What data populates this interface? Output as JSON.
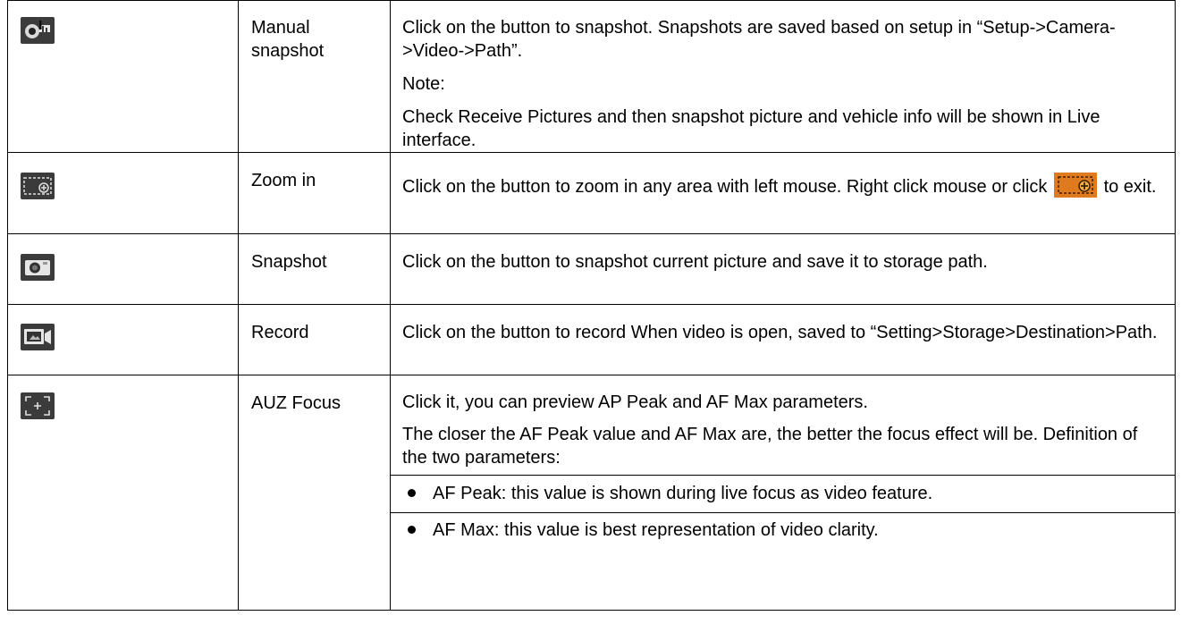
{
  "rows": [
    {
      "icon": "manual-snapshot-icon",
      "name": "Manual\nsnapshot",
      "desc": [
        "Click on the button to snapshot. Snapshots are saved based on setup in “Setup->Camera->Video->Path”.",
        "Note:",
        "Check Receive Pictures and then snapshot picture and vehicle info will be shown in Live interface."
      ]
    },
    {
      "icon": "zoom-in-icon",
      "name": "Zoom in",
      "desc_a": "Click on the button to zoom in any area with left mouse. Right click mouse or click",
      "desc_b": "to exit.",
      "inline_icon": "zoom-in-active-icon"
    },
    {
      "icon": "snapshot-camera-icon",
      "name": "Snapshot",
      "desc": "Click on the button to snapshot current picture and save it to storage path."
    },
    {
      "icon": "record-video-icon",
      "name": "Record",
      "desc": "Click on the button to record When video is open, saved to “Setting>Storage>Destination>Path."
    },
    {
      "icon": "auz-focus-icon",
      "name": "AUZ Focus",
      "desc": [
        "Click it, you can preview AP Peak and AF Max parameters.",
        "The closer the AF Peak value and AF Max are, the better the focus effect will be. Definition of the two parameters:"
      ],
      "bullets": [
        "AF Peak: this value is shown during live focus as video feature.",
        "AF Max: this value is best representation of video clarity."
      ]
    }
  ],
  "colors": {
    "icon_bg": "#3b3b3b",
    "accent_orange": "#e07a1e"
  }
}
